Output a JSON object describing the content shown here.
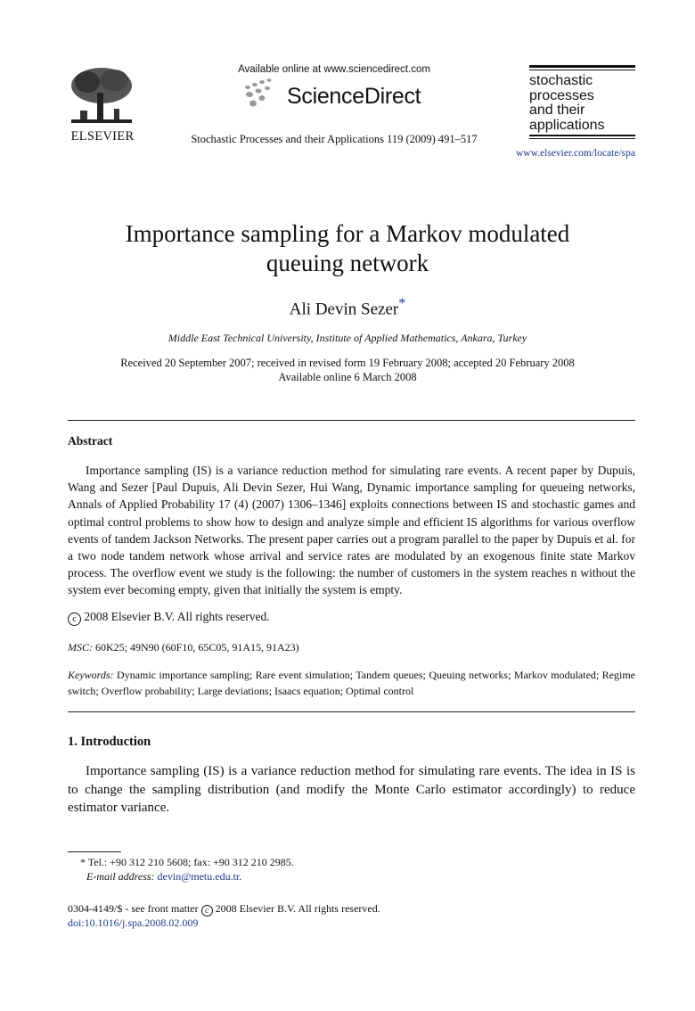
{
  "header": {
    "publisher_logo_text": "ELSEVIER",
    "available_online": "Available online at www.sciencedirect.com",
    "sciencedirect_brand": "ScienceDirect",
    "journal_reference": "Stochastic Processes and their Applications 119 (2009) 491–517",
    "journal_logo_lines": [
      "stochastic",
      "processes",
      "and their",
      "applications"
    ],
    "journal_url": "www.elsevier.com/locate/spa"
  },
  "article": {
    "title_line1": "Importance sampling for a Markov modulated",
    "title_line2": "queuing network",
    "author": "Ali Devin Sezer",
    "author_mark": "*",
    "affiliation": "Middle East Technical University, Institute of Applied Mathematics, Ankara, Turkey",
    "received": "Received 20 September 2007; received in revised form 19 February 2008; accepted 20 February 2008",
    "available": "Available online 6 March 2008"
  },
  "abstract": {
    "heading": "Abstract",
    "body": "Importance sampling (IS) is a variance reduction method for simulating rare events. A recent paper by Dupuis, Wang and Sezer [Paul Dupuis, Ali Devin Sezer, Hui Wang, Dynamic importance sampling for queueing networks, Annals of Applied Probability 17 (4) (2007) 1306–1346] exploits connections between IS and stochastic games and optimal control problems to show how to design and analyze simple and efficient IS algorithms for various overflow events of tandem Jackson Networks. The present paper carries out a program parallel to the paper by Dupuis et al. for a two node tandem network whose arrival and service rates are modulated by an exogenous finite state Markov process. The overflow event we study is the following: the number of customers in the system reaches n without the system ever becoming empty, given that initially the system is empty.",
    "copyright_symbol": "c",
    "copyright": "2008 Elsevier B.V. All rights reserved."
  },
  "msc": {
    "label": "MSC:",
    "value": "60K25; 49N90 (60F10, 65C05, 91A15, 91A23)"
  },
  "keywords": {
    "label": "Keywords:",
    "value": "Dynamic importance sampling; Rare event simulation; Tandem queues; Queuing networks; Markov modulated; Regime switch; Overflow probability; Large deviations; Isaacs equation; Optimal control"
  },
  "introduction": {
    "heading": "1.  Introduction",
    "body": "Importance sampling (IS) is a variance reduction method for simulating rare events. The idea in IS is to change the sampling distribution (and modify the Monte Carlo estimator accordingly) to reduce estimator variance."
  },
  "footnotes": {
    "tel": "* Tel.: +90 312 210 5608; fax: +90 312 210 2985.",
    "email_label": "E-mail address:",
    "email": "devin@metu.edu.tr",
    "email_trail": ".",
    "front_matter_a": "0304-4149/$ - see front matter",
    "front_matter_b": "2008 Elsevier B.V. All rights reserved.",
    "doi": "doi:10.1016/j.spa.2008.02.009"
  },
  "colors": {
    "link": "#1a3a8a",
    "text": "#111111"
  }
}
